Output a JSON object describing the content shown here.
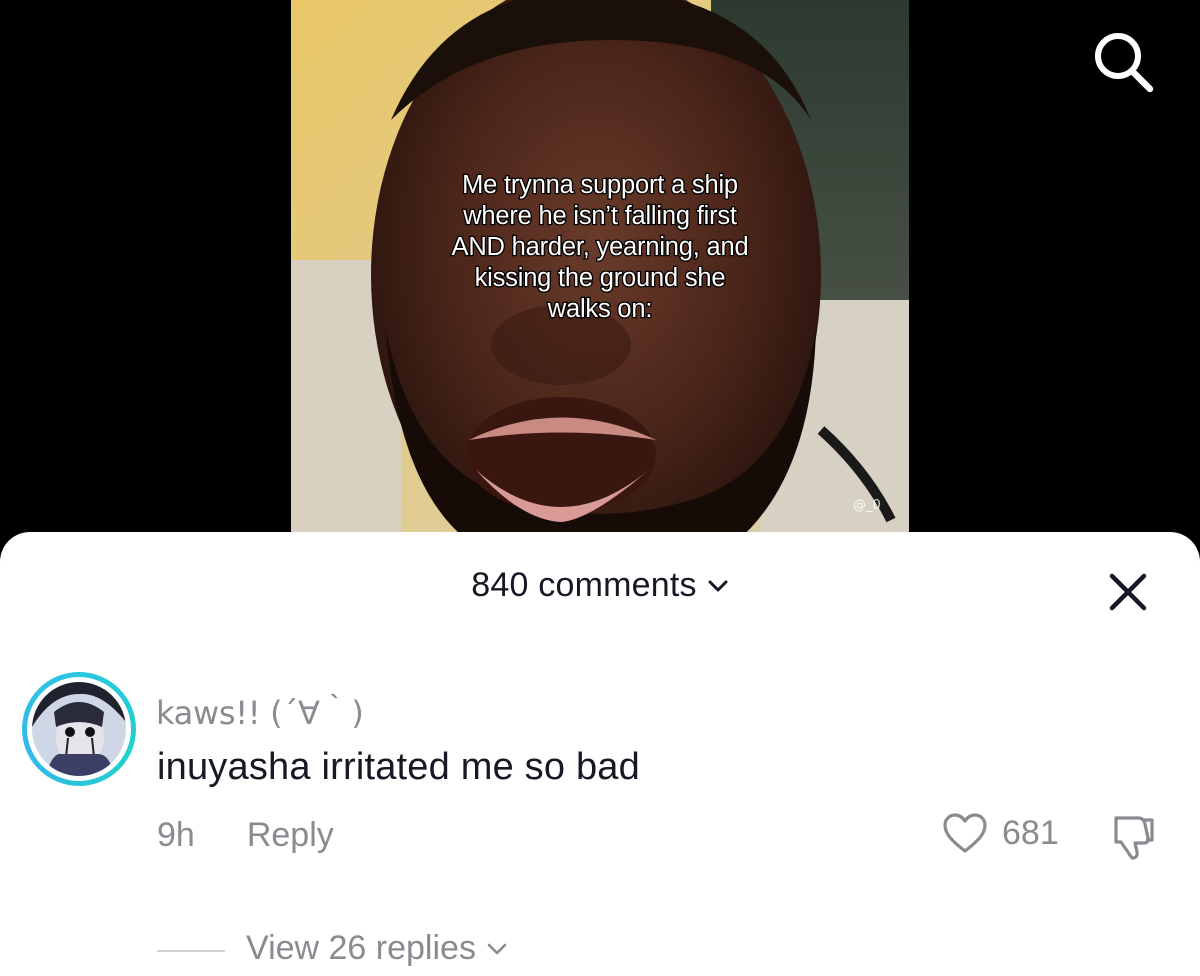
{
  "video": {
    "caption": "Me trynna support a ship\nwhere he isn’t falling first\nAND harder, yearning, and\nkissing the ground she\nwalks on:",
    "watermark": "@_0"
  },
  "top_bar": {
    "search_icon": "search-icon"
  },
  "comments_sheet": {
    "count_label": "840 comments",
    "sort_icon": "chevron-down-icon",
    "close_icon": "close-icon",
    "comment": {
      "username": "kaws!! (´∀｀)",
      "text": "inuyasha irritated me so bad",
      "time": "9h",
      "reply_label": "Reply",
      "like_count": "681",
      "like_icon": "heart-icon",
      "dislike_icon": "thumbs-down-icon",
      "view_replies_label": "View 26 replies",
      "avatar_ring_color": "#29c7e2"
    }
  },
  "colors": {
    "sheet_bg": "#ffffff",
    "primary_text": "#161823",
    "secondary_text": "#8a8b91"
  }
}
